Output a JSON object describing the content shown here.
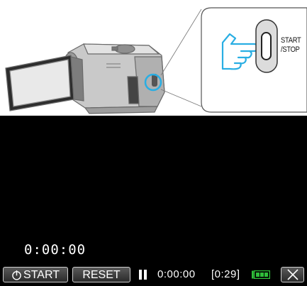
{
  "illustration": {
    "button_label": "START\n/STOP",
    "hand_color": "#29aee3",
    "highlight_color": "#29aee3"
  },
  "screen": {
    "elapsed_time": "0:00:00",
    "start_button": "START",
    "reset_button": "RESET",
    "recording_time": "0:00:00",
    "remaining_time": "[0:29]",
    "battery_color": "#2fbf3a",
    "icons": {
      "stopwatch": "stopwatch-icon",
      "pause": "pause-icon",
      "battery": "battery-icon",
      "close": "close-icon"
    }
  }
}
